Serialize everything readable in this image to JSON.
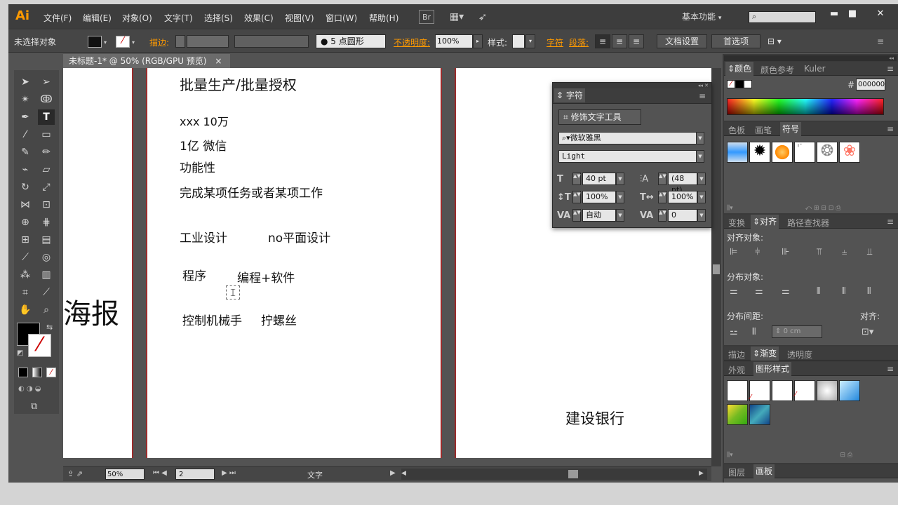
{
  "menubar": {
    "logo": "Ai",
    "items": [
      "文件(F)",
      "编辑(E)",
      "对象(O)",
      "文字(T)",
      "选择(S)",
      "效果(C)",
      "视图(V)",
      "窗口(W)",
      "帮助(H)"
    ],
    "bridge": "Br",
    "workspace": "基本功能",
    "search_placeholder": ""
  },
  "controlbar": {
    "selection_status": "未选择对象",
    "stroke_label": "描边:",
    "brush_label": "5 点圆形",
    "opacity_label": "不透明度:",
    "opacity_value": "100%",
    "style_label": "样式:",
    "char_link": "字符",
    "para_link": "段落:",
    "doc_setup_button": "文档设置",
    "preferences_button": "首选项"
  },
  "document": {
    "tab_title": "未标题-1* @ 50% (RGB/GPU 预览)",
    "close_glyph": "×",
    "page1_text": "海报",
    "page2_lines": [
      "批量生产/批量授权",
      "xxx  10万",
      "1亿  微信",
      "功能性",
      "完成某项任务或者某项工作",
      "工业设计",
      "no平面设计",
      "程序",
      "编程+软件",
      "控制机械手",
      "拧螺丝"
    ],
    "page3_text": "建设银行"
  },
  "statusbar": {
    "zoom": "50%",
    "artboard": "2",
    "tool_name": "文字"
  },
  "color_panel": {
    "tabs": [
      "颜色",
      "颜色参考",
      "Kuler"
    ],
    "hex_label": "#",
    "hex_value": "000000"
  },
  "swatches_panel": {
    "tabs": [
      "色板",
      "画笔",
      "符号"
    ]
  },
  "align_panel": {
    "tabs": [
      "变换",
      "对齐",
      "路径查找器"
    ],
    "align_objects": "对齐对象:",
    "distribute_objects": "分布对象:",
    "distribute_spacing": "分布间距:",
    "align_to": "对齐:",
    "spacing_value": "0 cm"
  },
  "stroke_panel": {
    "tabs": [
      "描边",
      "渐变",
      "透明度"
    ]
  },
  "graphic_styles_panel": {
    "tabs": [
      "外观",
      "图形样式"
    ]
  },
  "layers_panel": {
    "tabs": [
      "图层",
      "画板"
    ]
  },
  "char_panel": {
    "title": "字符",
    "touch_tool": "修饰文字工具",
    "font_family": "微软雅黑",
    "font_style": "Light",
    "font_size": "40 pt",
    "leading": "(48 pt)",
    "v_scale": "100%",
    "h_scale": "100%",
    "kerning": "自动",
    "tracking": "0"
  },
  "colors": {
    "app_bg": "#535353",
    "accent": "#ff9a00",
    "guide_red": "#9b2b2b"
  }
}
